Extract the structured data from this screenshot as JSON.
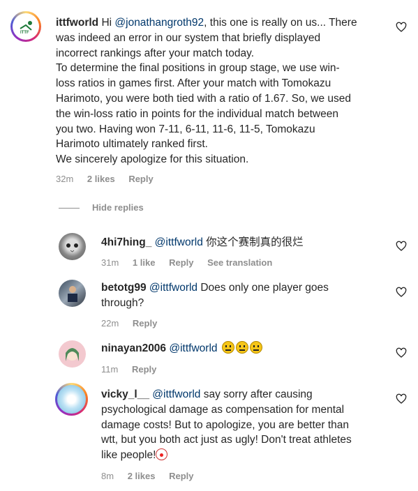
{
  "comments": [
    {
      "username": "ittfworld",
      "mention": "@jonathangroth92",
      "text_before": "Hi",
      "text_after": ", this one is really on us... There was indeed an error in our system that briefly displayed incorrect rankings after your match today. To determine the final positions in group stage, we use win-loss ratios in games first. After your match with Tomokazu Harimoto, you were both tied with a ratio of 1.67. So, we used the win-loss ratio in points for the individual match between you two. Having won 7-11, 6-11, 11-6, 11-5, Tomokazu Harimoto ultimately ranked first. We sincerely apologize for this situation.",
      "lines": [
        "There",
        "was indeed an error in our system that briefly displayed",
        "incorrect rankings after your match today.",
        "To determine the final positions in group stage, we use win-",
        "loss ratios in games first. After your match with Tomokazu",
        "Harimoto, you were both tied with a ratio of 1.67. So, we used",
        "the win-loss ratio in points for the individual match between",
        "you two. Having won 7-11, 6-11, 11-6, 11-5, Tomokazu",
        "Harimoto ultimately ranked first.",
        "We sincerely apologize for this situation."
      ],
      "first_line_tail": ", this one is really on us... There",
      "time": "32m",
      "likes": "2 likes",
      "reply": "Reply"
    },
    {
      "username": "4hi7hing_",
      "mention": "@ittfworld",
      "text": "你这个赛制真的很烂",
      "time": "31m",
      "likes": "1 like",
      "reply": "Reply",
      "translation": "See translation"
    },
    {
      "username": "betotg99",
      "mention": "@ittfworld",
      "text_line1": "Does only one player goes",
      "text_line2": "through?",
      "time": "22m",
      "reply": "Reply"
    },
    {
      "username": "ninayan2006",
      "mention": "@ittfworld",
      "emoji_name": "neutral-face-emoji",
      "time": "11m",
      "reply": "Reply"
    },
    {
      "username": "vicky_l__",
      "mention": "@ittfworld",
      "text_line1": "say sorry after causing",
      "lines": [
        "psychological damage as compensation for mental",
        "damage costs! But to apologize, you are better than",
        "wtt, but you both act just as ugly! Don't treat athletes",
        "like people!"
      ],
      "emoji_name": "clown-face-emoji",
      "time": "8m",
      "likes": "2 likes",
      "reply": "Reply"
    }
  ],
  "hide_replies": "Hide replies",
  "colors": {
    "text": "#262626",
    "mention": "#00376b",
    "meta": "#8e8e8e"
  }
}
